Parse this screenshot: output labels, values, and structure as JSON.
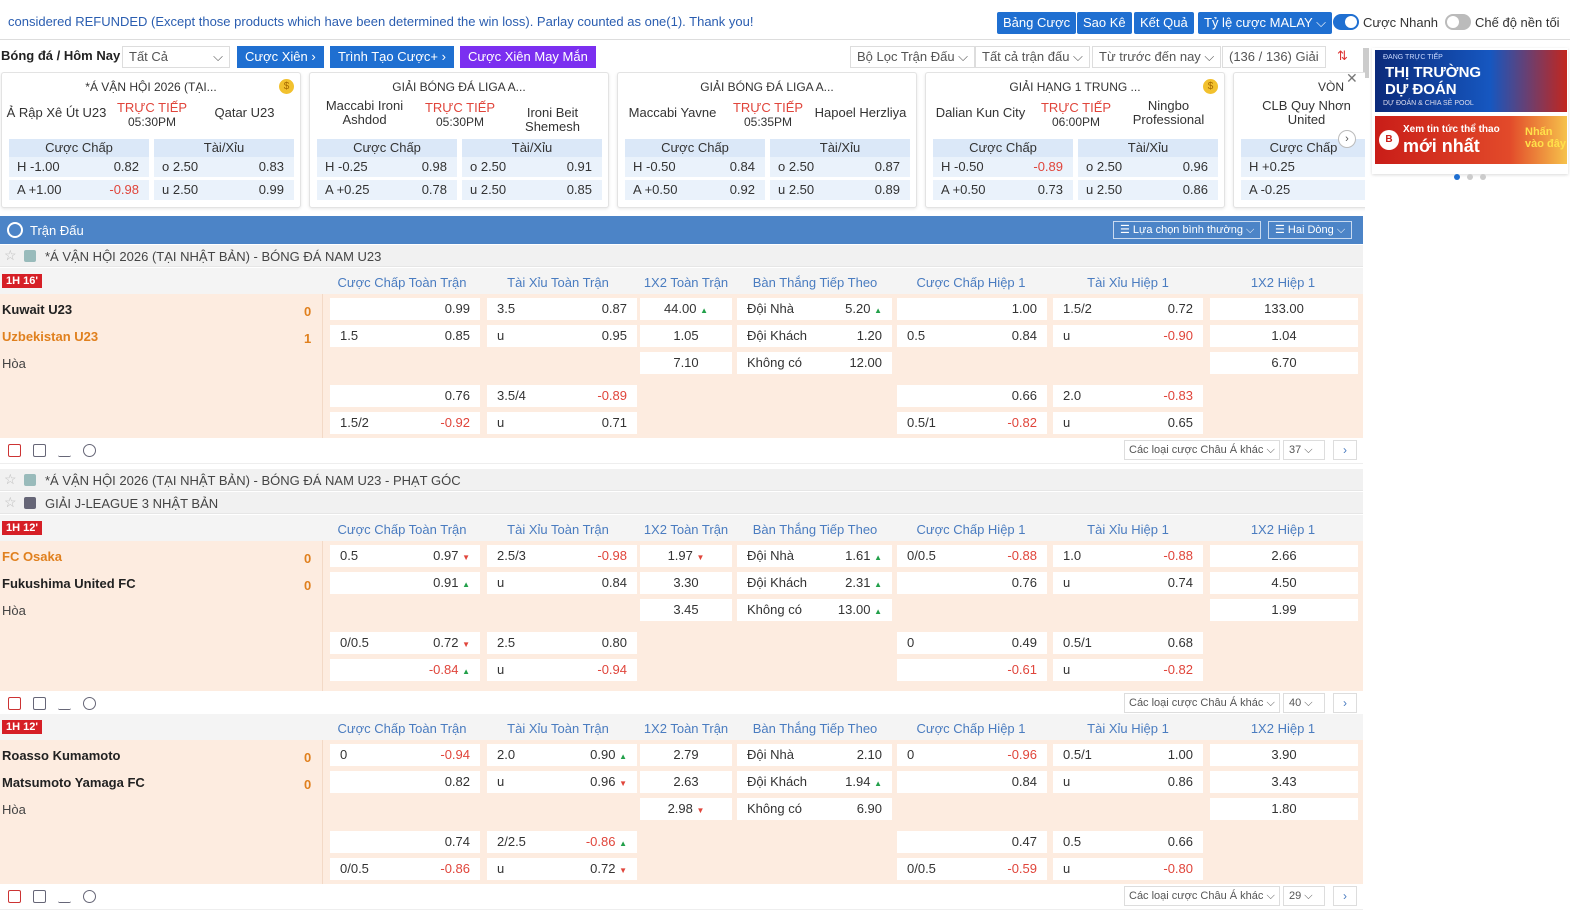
{
  "topbar": {
    "notice": "considered REFUNDED (Except those products which have been determined the win loss). Parlay counted as one(1). Thank you!",
    "btn_bang": "Bảng Cược",
    "btn_sao": "Sao Kê",
    "btn_ket": "Kết Quả",
    "btn_tyle": "Tỷ lệ cược MALAY ⌵",
    "toggle1": "Cược Nhanh",
    "toggle2": "Chế độ nền tối"
  },
  "filter": {
    "title": "Bóng đá / Hôm Nay",
    "all": "Tất Cả",
    "xien": "Cược Xiên ›",
    "taocuoc": "Trình Tạo Cược+ ›",
    "mayman": "Cược Xiên May Mắn",
    "boloc": "Bộ Lọc Trận Đấu ⌵",
    "tatca": "Tất cả trận đấu ⌵",
    "truoc": "Từ trước đến nay ⌵",
    "giai": "(136 / 136) Giải"
  },
  "cards": [
    {
      "league": "*Á VẬN HỘI 2026 (TẠI...",
      "home": "Ả Rập Xê Út U23",
      "away": "Qatar U23",
      "live": "TRỰC TIẾP",
      "time": "05:30PM",
      "h1": "H -1.00",
      "v1": "0.82",
      "o1": "o 2.50",
      "w1": "0.83",
      "h2": "A +1.00",
      "v2": "-0.98",
      "o2": "u 2.50",
      "w2": "0.99"
    },
    {
      "league": "GIẢI BÓNG ĐÁ LIGA A...",
      "home": "Maccabi Ironi Ashdod",
      "away": "Ironi Beit Shemesh",
      "live": "TRỰC TIẾP",
      "time": "05:30PM",
      "h1": "H -0.25",
      "v1": "0.98",
      "o1": "o 2.50",
      "w1": "0.91",
      "h2": "A +0.25",
      "v2": "0.78",
      "o2": "u 2.50",
      "w2": "0.85"
    },
    {
      "league": "GIẢI BÓNG ĐÁ LIGA A...",
      "home": "Maccabi Yavne",
      "away": "Hapoel Herzliya",
      "live": "TRỰC TIẾP",
      "time": "05:35PM",
      "h1": "H -0.50",
      "v1": "0.84",
      "o1": "o 2.50",
      "w1": "0.87",
      "h2": "A +0.50",
      "v2": "0.92",
      "o2": "u 2.50",
      "w2": "0.89"
    },
    {
      "league": "GIẢI HẠNG 1 TRUNG ...",
      "home": "Dalian Kun City",
      "away": "Ningbo Professional",
      "live": "TRỰC TIẾP",
      "time": "06:00PM",
      "h1": "H -0.50",
      "v1": "-0.89",
      "o1": "o 2.50",
      "w1": "0.96",
      "h2": "A +0.50",
      "v2": "0.73",
      "o2": "u 2.50",
      "w2": "0.86"
    },
    {
      "league": "VÒN",
      "home": "CLB Quy Nhơn United",
      "h1": "H +0.25",
      "h2": "A -0.25"
    }
  ],
  "card_hdr": {
    "chap": "Cược Chấp",
    "taixiu": "Tài/Xỉu"
  },
  "banner": {
    "top_small": "ĐANG TRỰC TIẾP",
    "title": "THỊ TRƯỜNG DỰ ĐOÁN",
    "sub": "DỰ ĐOÁN & CHIA SẺ POOL",
    "b2a": "Xem tin tức thể thao",
    "b2b": "mới nhất",
    "b2c": "Nhấn vào đây"
  },
  "section": {
    "title": "Trận Đấu",
    "sel1": "☰ Lựa chọn bình thường ⌵",
    "sel2": "☰ Hai Dòng ⌵"
  },
  "cols": [
    "Cược Chấp Toàn Trận",
    "Tài Xỉu Toàn Trận",
    "1X2 Toàn Trận",
    "Bàn Thắng Tiếp Theo",
    "Cược Chấp Hiệp 1",
    "Tài Xỉu Hiệp 1",
    "1X2 Hiệp 1"
  ],
  "leagues": {
    "l1": "*Á VẬN HỘI 2026 (TẠI NHẬT BẢN) - BÓNG ĐÁ NAM U23",
    "l2": "*Á VẬN HỘI 2026 (TẠI NHẬT BẢN) - BÓNG ĐÁ NAM U23 - PHẠT GÓC",
    "l3": "GIẢI J-LEAGUE 3 NHẬT BẢN"
  },
  "tools": {
    "more": "Các loại cược Châu Á khác ⌵",
    "cnt1": "37 ⌵",
    "cnt2": "40 ⌵",
    "cnt3": "29 ⌵"
  },
  "matches": [
    {
      "badge": "1H 16'",
      "home": "Kuwait U23",
      "away": "Uzbekistan U23",
      "draw": "Hòa",
      "hs": "0",
      "as": "1",
      "r1": [
        "",
        "0.99",
        "3.5",
        "0.87",
        "44.00",
        "Đội Nhà",
        "5.20",
        "",
        "1.00",
        "1.5/2",
        "0.72",
        "133.00"
      ],
      "r2": [
        "1.5",
        "0.85",
        "u",
        "0.95",
        "1.05",
        "Đội Khách",
        "1.20",
        "0.5",
        "0.84",
        "u",
        "-0.90",
        "1.04"
      ],
      "r3": [
        "7.10",
        "Không có",
        "12.00",
        "6.70"
      ],
      "r4": [
        "",
        "0.76",
        "3.5/4",
        "-0.89",
        "",
        "0.66",
        "2.0",
        "-0.83"
      ],
      "r5": [
        "1.5/2",
        "-0.92",
        "u",
        "0.71",
        "0.5/1",
        "-0.82",
        "u",
        "0.65"
      ]
    },
    {
      "badge": "1H 12'",
      "home": "FC Osaka",
      "away": "Fukushima United FC",
      "draw": "Hòa",
      "hs": "0",
      "as": "0",
      "r1": [
        "0.5",
        "0.97",
        "2.5/3",
        "-0.98",
        "1.97",
        "Đội Nhà",
        "1.61",
        "0/0.5",
        "-0.88",
        "1.0",
        "-0.88",
        "2.66"
      ],
      "r2": [
        "",
        "0.91",
        "u",
        "0.84",
        "3.30",
        "Đội Khách",
        "2.31",
        "",
        "0.76",
        "u",
        "0.74",
        "4.50"
      ],
      "r3": [
        "3.45",
        "Không có",
        "13.00",
        "1.99"
      ],
      "r4": [
        "0/0.5",
        "0.72",
        "2.5",
        "0.80",
        "0",
        "0.49",
        "0.5/1",
        "0.68"
      ],
      "r5": [
        "",
        "-0.84",
        "u",
        "-0.94",
        "",
        "-0.61",
        "u",
        "-0.82"
      ]
    },
    {
      "badge": "1H 12'",
      "home": "Roasso Kumamoto",
      "away": "Matsumoto Yamaga FC",
      "draw": "Hòa",
      "hs": "0",
      "as": "0",
      "r1": [
        "0",
        "-0.94",
        "2.0",
        "0.90",
        "2.79",
        "Đội Nhà",
        "2.10",
        "0",
        "-0.96",
        "0.5/1",
        "1.00",
        "3.90"
      ],
      "r2": [
        "",
        "0.82",
        "u",
        "0.96",
        "2.63",
        "Đội Khách",
        "1.94",
        "",
        "0.84",
        "u",
        "0.86",
        "3.43"
      ],
      "r3": [
        "2.98",
        "Không có",
        "6.90",
        "1.80"
      ],
      "r4": [
        "",
        "0.74",
        "2/2.5",
        "-0.86",
        "",
        "0.47",
        "0.5",
        "0.66"
      ],
      "r5": [
        "0/0.5",
        "-0.86",
        "u",
        "0.72",
        "0/0.5",
        "-0.59",
        "u",
        "-0.80"
      ]
    }
  ]
}
